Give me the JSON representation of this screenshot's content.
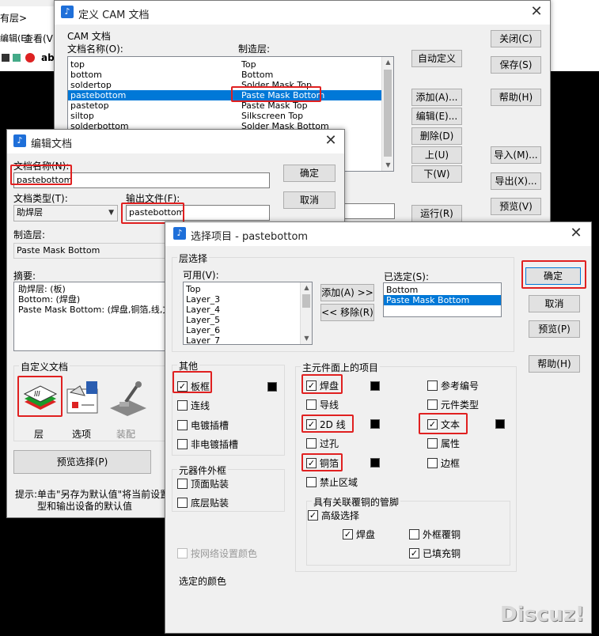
{
  "colors": {
    "highlight": "#e02020",
    "selection": "#0078d7"
  },
  "background": {
    "menu_text": "有层>",
    "menu_items": [
      "编辑(E)",
      "查看(V)"
    ],
    "partial_text": "ab"
  },
  "cam_window": {
    "title": "定义 CAM 文档",
    "group_label": "CAM 文档",
    "col_doc": "文档名称(O):",
    "col_layer": "制造层:",
    "rows": [
      {
        "doc": "top",
        "layer": "Top"
      },
      {
        "doc": "bottom",
        "layer": "Bottom"
      },
      {
        "doc": "soldertop",
        "layer": "Solder Mask Top"
      },
      {
        "doc": "pastebottom",
        "layer": "Paste Mask Bottom"
      },
      {
        "doc": "pastetop",
        "layer": "Paste Mask Top"
      },
      {
        "doc": "siltop",
        "layer": "Silkscreen Top"
      },
      {
        "doc": "solderbottom",
        "layer": "Solder Mask Bottom"
      }
    ],
    "buttons": {
      "close": "关闭(C)",
      "save": "保存(S)",
      "help": "帮助(H)",
      "auto": "自动定义",
      "add": "添加(A)...",
      "edit": "编辑(E)...",
      "delete": "删除(D)",
      "up": "上(U)",
      "down": "下(W)",
      "run": "运行(R)",
      "import": "导入(M)...",
      "export": "导出(X)...",
      "preview": "预览(V)"
    }
  },
  "edit_window": {
    "title": "编辑文档",
    "doc_name_label": "文档名称(N):",
    "doc_name_value": "pastebottom",
    "doc_type_label": "文档类型(T):",
    "doc_type_value": "助焊层",
    "output_label": "输出文件(F):",
    "output_value": "pastebottom",
    "layer_label": "制造层:",
    "layer_value": "Paste Mask Bottom",
    "summary_label": "摘要:",
    "summary_lines": [
      "助焊层: (板)",
      "Bottom: (焊盘)",
      "Paste Mask Bottom: (焊盘,铜箔,线,文本"
    ],
    "ok": "确定",
    "cancel": "取消",
    "custom_label": "自定义文档",
    "icon_layers": "层",
    "icon_options": "选项",
    "icon_assembly": "装配",
    "preview_select": "预览选择(P)",
    "hint_line1": "提示:单击\"另存为默认值\"将当前设置",
    "hint_line2": "型和输出设备的默认值"
  },
  "select_window": {
    "title": "选择项目 - pastebottom",
    "layer_select": "层选择",
    "available_label": "可用(V):",
    "available": [
      "Top",
      "Layer_3",
      "Layer_4",
      "Layer_5",
      "Layer_6",
      "Layer_7"
    ],
    "add_btn": "添加(A) >>",
    "remove_btn": "<< 移除(R)",
    "selected_label": "已选定(S):",
    "selected": [
      "Bottom",
      "Paste Mask Bottom"
    ],
    "ok": "确定",
    "cancel": "取消",
    "preview": "预览(P)",
    "help": "帮助(H)",
    "other_title": "其他",
    "other": [
      {
        "label": "板框",
        "checked": true
      },
      {
        "label": "连线",
        "checked": false
      },
      {
        "label": "电镀插槽",
        "checked": false
      },
      {
        "label": "非电镀插槽",
        "checked": false
      }
    ],
    "component_outline_title": "元器件外框",
    "component_outline": [
      {
        "label": "顶面贴装",
        "checked": false
      },
      {
        "label": "底层贴装",
        "checked": false
      }
    ],
    "net_color": "按网络设置颜色",
    "main_title": "主元件面上的项目",
    "main_left": [
      {
        "label": "焊盘",
        "checked": true
      },
      {
        "label": "导线",
        "checked": false
      },
      {
        "label": "2D 线",
        "checked": true
      },
      {
        "label": "过孔",
        "checked": false
      },
      {
        "label": "铜箔",
        "checked": true
      },
      {
        "label": "禁止区域",
        "checked": false
      }
    ],
    "main_right": [
      {
        "label": "参考编号",
        "checked": false
      },
      {
        "label": "元件类型",
        "checked": false
      },
      {
        "label": "文本",
        "checked": true
      },
      {
        "label": "属性",
        "checked": false
      },
      {
        "label": "边框",
        "checked": false
      }
    ],
    "pour_title": "具有关联覆铜的管脚",
    "pour_advanced": {
      "label": "高级选择",
      "checked": true
    },
    "pour_pad": {
      "label": "焊盘",
      "checked": true
    },
    "pour_outline": {
      "label": "外框覆铜",
      "checked": false
    },
    "pour_filled": {
      "label": "已填充铜",
      "checked": true
    },
    "selected_color": "选定的颜色"
  },
  "watermark": "Discuz!"
}
